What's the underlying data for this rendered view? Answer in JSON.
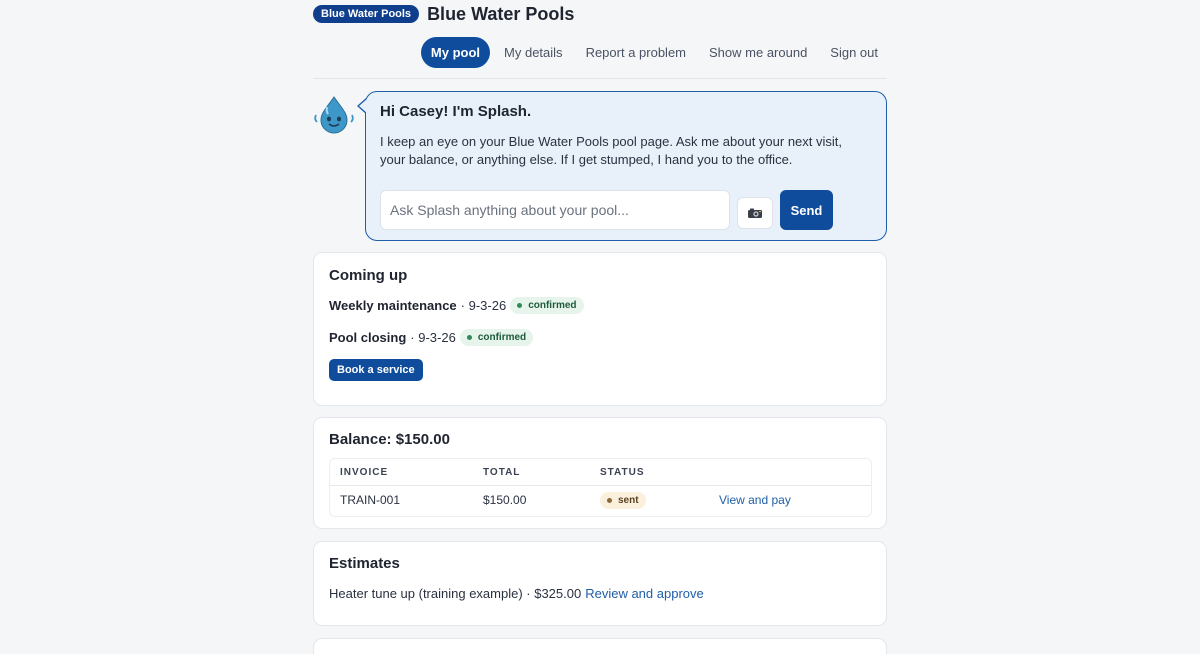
{
  "brand": {
    "pill": "Blue Water Pools",
    "title": "Blue Water Pools"
  },
  "nav": {
    "items": [
      {
        "label": "My pool",
        "active": true
      },
      {
        "label": "My details"
      },
      {
        "label": "Report a problem"
      },
      {
        "label": "Show me around"
      },
      {
        "label": "Sign out"
      }
    ]
  },
  "splash": {
    "title": "Hi Casey! I'm Splash.",
    "text": "I keep an eye on your Blue Water Pools pool page. Ask me about your next visit, your balance, or anything else. If I get stumped, I hand you to the office.",
    "input_placeholder": "Ask Splash anything about your pool...",
    "camera_icon": "camera-icon",
    "send_label": "Send"
  },
  "coming_up": {
    "title": "Coming up",
    "items": [
      {
        "service": "Weekly maintenance",
        "date": "· 9-3-26",
        "status": "confirmed"
      },
      {
        "service": "Pool closing",
        "date": "· 9-3-26",
        "status": "confirmed"
      }
    ],
    "book_label": "Book a service"
  },
  "balance": {
    "title": "Balance: $150.00",
    "headers": [
      "INVOICE",
      "TOTAL",
      "STATUS"
    ],
    "rows": [
      {
        "invoice": "TRAIN-001",
        "total": "$150.00",
        "status": "sent",
        "action": "View and pay"
      }
    ]
  },
  "estimates": {
    "title": "Estimates",
    "item": "Heater tune up (training example) · $325.00",
    "action": "Review and approve"
  },
  "colors": {
    "primary": "#0f4c9c",
    "confirmed_dot": "#2e8b57",
    "sent_dot": "#8a6a3a",
    "link": "#1f5ea8"
  }
}
